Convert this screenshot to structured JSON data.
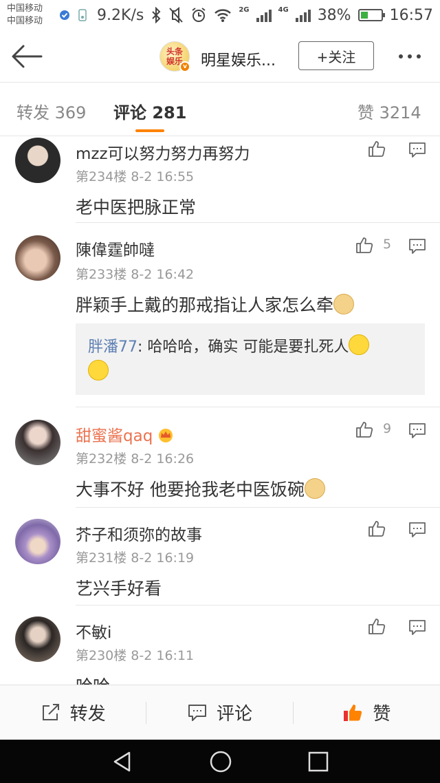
{
  "status_bar": {
    "carrier_1": "中国移动",
    "carrier_2": "中国移动",
    "speed": "9.2K/s",
    "network_1": "2G",
    "network_2": "4G",
    "battery": "38%",
    "battery_level": 0.38,
    "time": "16:57"
  },
  "nav": {
    "account_name": "明星娱乐...",
    "avatar_text_1": "头条",
    "avatar_text_2": "娱乐",
    "follow_label": "+关注"
  },
  "tabs": {
    "repost": "转发 369",
    "comment": "评论 281",
    "like": "赞 3214"
  },
  "comments": [
    {
      "user": "mzz可以努力努力再努力",
      "meta": "第234楼  8-2 16:55",
      "text": "老中医把脉正常",
      "likes": ""
    },
    {
      "user": "陳偉霆帥噠",
      "meta": "第233楼  8-2 16:42",
      "text": "胖颖手上戴的那戒指让人家怎么牵",
      "likes": "5",
      "reply": {
        "user": "胖潘77",
        "text_1": ": 哈哈哈，确实 可能是要扎死人"
      }
    },
    {
      "user": "甜蜜酱qaq",
      "meta": "第232楼  8-2 16:26",
      "text": "大事不好 他要抢我老中医饭碗",
      "likes": "9"
    },
    {
      "user": "芥子和须弥的故事",
      "meta": "第231楼  8-2 16:19",
      "text": "艺兴手好看",
      "likes": ""
    },
    {
      "user": "不敏i",
      "meta": "第230楼  8-2 16:11",
      "text": "哈哈",
      "likes": ""
    }
  ],
  "bottom_bar": {
    "repost": "转发",
    "comment": "评论",
    "like": "赞"
  },
  "colors": {
    "accent": "#ff8200",
    "vip_name": "#eb7350",
    "reply_user": "#5d7fb3"
  }
}
